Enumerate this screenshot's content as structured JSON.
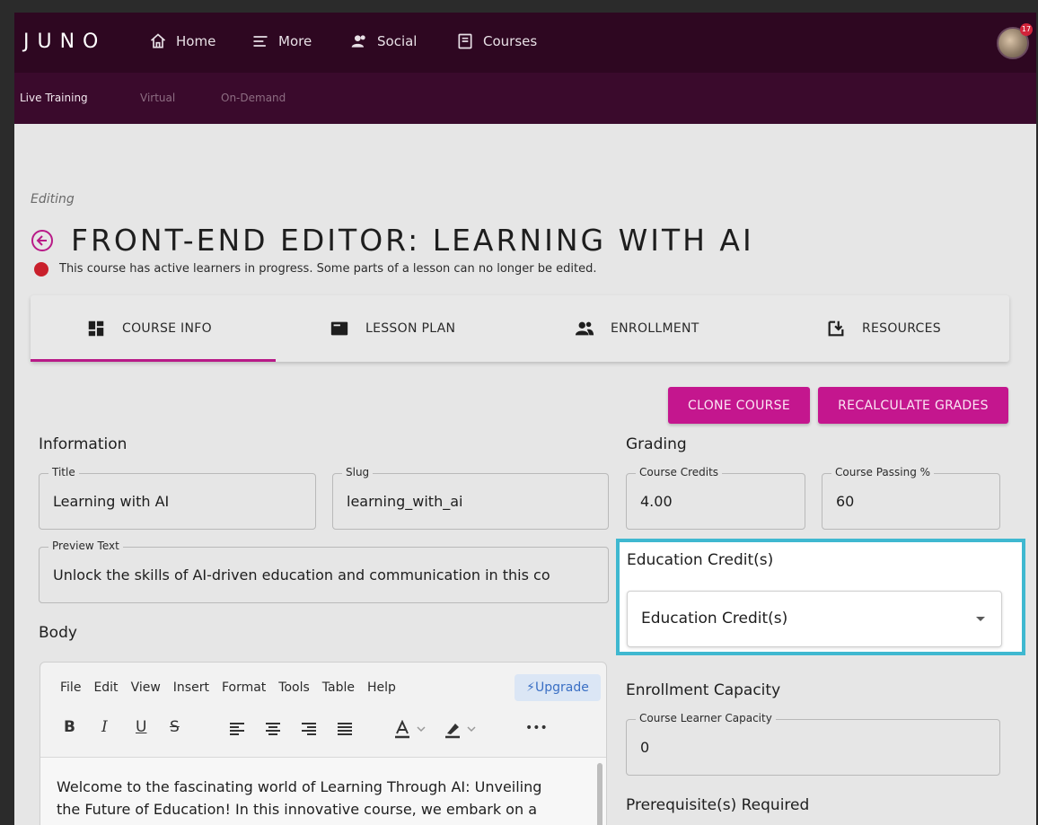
{
  "app": {
    "logo": "JUNO"
  },
  "topnav": {
    "items": [
      {
        "label": "Home",
        "icon": "home-icon"
      },
      {
        "label": "More",
        "icon": "menu-icon"
      },
      {
        "label": "Social",
        "icon": "people-icon"
      },
      {
        "label": "Courses",
        "icon": "book-icon"
      }
    ],
    "avatar_badge": "17"
  },
  "subnav": {
    "items": [
      "Live Training",
      "Virtual",
      "On-Demand"
    ]
  },
  "page": {
    "status": "Editing",
    "title": "FRONT-END EDITOR: LEARNING WITH AI",
    "warning": "This course has active learners in progress. Some parts of a lesson can no longer be edited."
  },
  "tabs": [
    {
      "label": "COURSE INFO",
      "icon": "dashboard-icon",
      "active": true
    },
    {
      "label": "LESSON PLAN",
      "icon": "card-icon"
    },
    {
      "label": "ENROLLMENT",
      "icon": "group-icon"
    },
    {
      "label": "RESOURCES",
      "icon": "download-icon"
    }
  ],
  "actions": {
    "clone": "CLONE COURSE",
    "recalculate": "RECALCULATE GRADES"
  },
  "information": {
    "heading": "Information",
    "title_label": "Title",
    "title_value": "Learning with AI",
    "slug_label": "Slug",
    "slug_value": "learning_with_ai",
    "preview_label": "Preview Text",
    "preview_value": "Unlock the skills of AI-driven education and communication in this co"
  },
  "grading": {
    "heading": "Grading",
    "credits_label": "Course Credits",
    "credits_value": "4.00",
    "passing_label": "Course Passing %",
    "passing_value": "60"
  },
  "education_credits": {
    "label": "Education Credit(s)",
    "selected": "Education Credit(s)"
  },
  "enrollment": {
    "heading": "Enrollment Capacity",
    "capacity_label": "Course Learner Capacity",
    "capacity_value": "0",
    "prereq_heading": "Prerequisite(s) Required"
  },
  "body": {
    "heading": "Body",
    "menu": [
      "File",
      "Edit",
      "View",
      "Insert",
      "Format",
      "Tools",
      "Table",
      "Help"
    ],
    "upgrade": "⚡Upgrade",
    "toolbar": {
      "bold": "B",
      "italic": "I",
      "underline": "U",
      "strike": "S",
      "more": "•••"
    },
    "content": "Welcome to the fascinating world of Learning Through AI: Unveiling the Future of Education! In this innovative course, we embark on a"
  },
  "colors": {
    "topbar": "#2e0721",
    "accent": "#c4168e",
    "highlight": "#3fb8d0"
  }
}
